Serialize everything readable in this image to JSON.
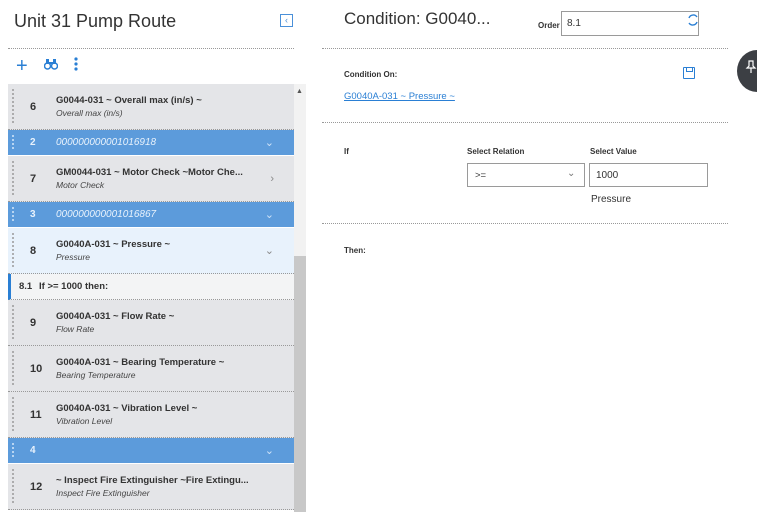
{
  "route": {
    "title": "Unit 31 Pump Route"
  },
  "toolbar": {
    "add_icon": "plus-icon",
    "find_icon": "binoculars-icon",
    "more_icon": "vertical-dots-icon"
  },
  "list": {
    "rows": [
      {
        "kind": "step",
        "num": "6",
        "title": "G0044-031 ~ Overall max (in/s) ~",
        "subtitle": "Overall max (in/s)",
        "chevron": ""
      },
      {
        "kind": "group",
        "num": "2",
        "title": "000000000001016918",
        "chevron": "⌄"
      },
      {
        "kind": "step",
        "num": "7",
        "title": "GM0044-031 ~ Motor Check ~Motor Che...",
        "subtitle": "Motor Check",
        "chevron": "›"
      },
      {
        "kind": "group",
        "num": "3",
        "title": "000000000001016867",
        "chevron": "⌄"
      },
      {
        "kind": "step-active",
        "num": "8",
        "title": "G0040A-031 ~ Pressure ~",
        "subtitle": "Pressure",
        "chevron": "⌄"
      },
      {
        "kind": "cond",
        "num": "8.1",
        "title": "If >= 1000 then:"
      },
      {
        "kind": "step",
        "num": "9",
        "title": "G0040A-031 ~ Flow Rate ~",
        "subtitle": "Flow Rate",
        "chevron": ""
      },
      {
        "kind": "step",
        "num": "10",
        "title": "G0040A-031 ~ Bearing Temperature ~",
        "subtitle": "Bearing Temperature",
        "chevron": ""
      },
      {
        "kind": "step",
        "num": "11",
        "title": "G0040A-031 ~ Vibration Level ~",
        "subtitle": "Vibration Level",
        "chevron": ""
      },
      {
        "kind": "group",
        "num": "4",
        "title": "",
        "chevron": "⌄"
      },
      {
        "kind": "step",
        "num": "12",
        "title": "~ Inspect Fire Extinguisher ~Fire Extingu...",
        "subtitle": "Inspect Fire Extinguisher",
        "chevron": ""
      }
    ]
  },
  "condition": {
    "title": "Condition: G0040...",
    "order_label": "Order",
    "order_value": "8.1",
    "condition_on_label": "Condition On:",
    "condition_on_link": "G0040A-031 ~ Pressure ~",
    "if_label": "If",
    "relation_label": "Select Relation",
    "relation_value": ">=",
    "value_label": "Select Value",
    "value_value": "1000",
    "value_unit": "Pressure",
    "then_label": "Then:"
  },
  "colors": {
    "accent": "#2a7fd4",
    "group_bg": "#5c9bdb",
    "step_bg": "#e4e5e8",
    "active_bg": "#e8f2fc"
  }
}
